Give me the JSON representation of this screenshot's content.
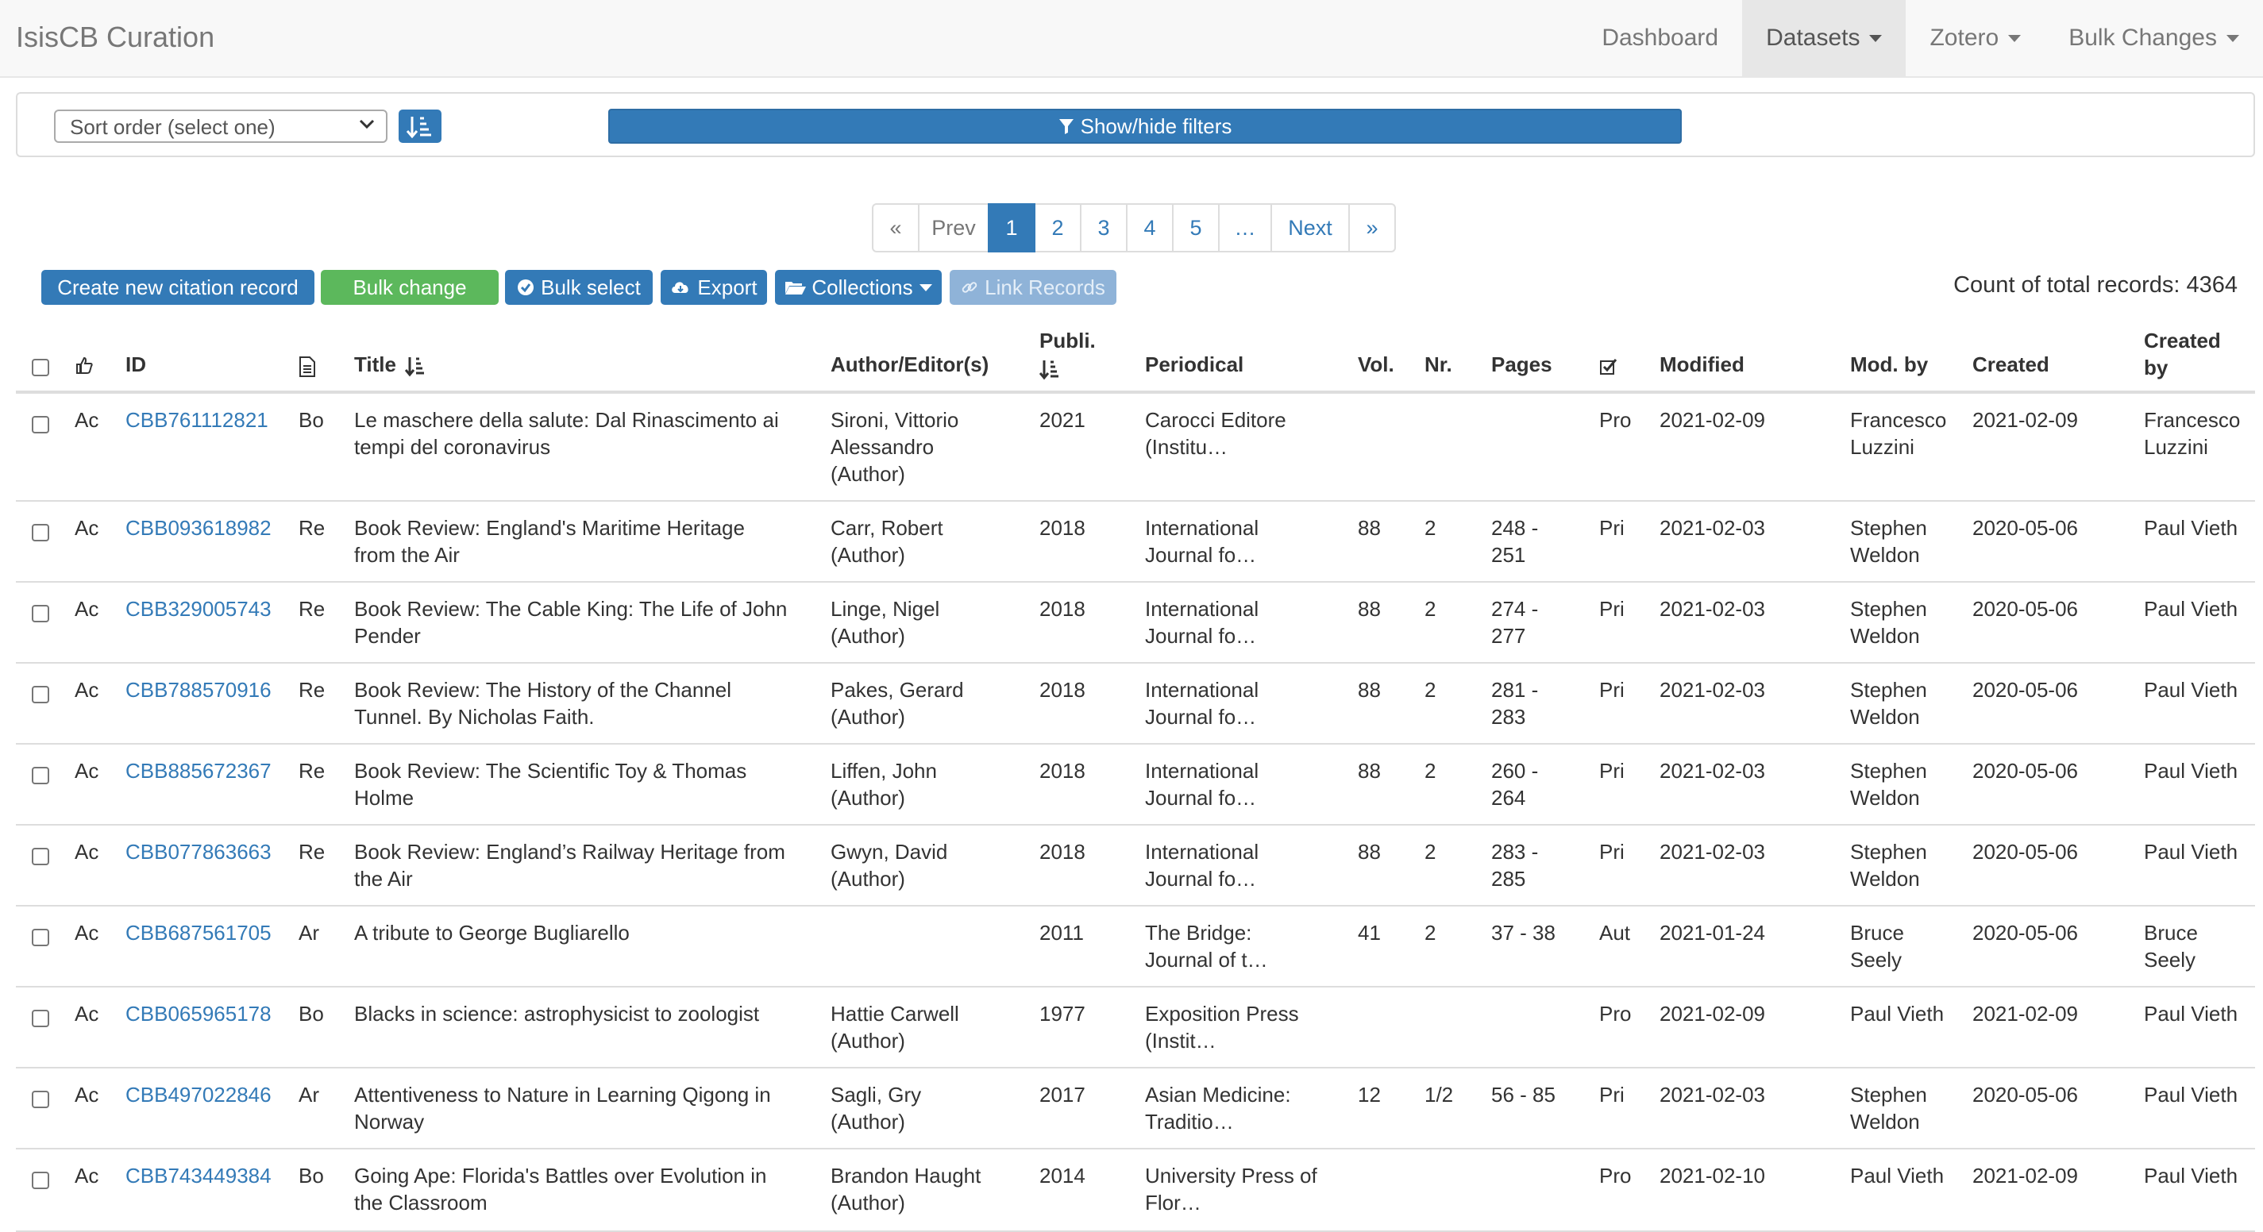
{
  "navbar": {
    "brand": "IsisCB Curation",
    "items": [
      {
        "label": "Dashboard",
        "dropdown": false,
        "active": false
      },
      {
        "label": "Datasets",
        "dropdown": true,
        "active": true
      },
      {
        "label": "Zotero",
        "dropdown": true,
        "active": false
      },
      {
        "label": "Bulk Changes",
        "dropdown": true,
        "active": false
      }
    ]
  },
  "filters": {
    "sort_placeholder": "Sort order (select one)",
    "show_hide_label": "Show/hide filters"
  },
  "pagination": {
    "first": "«",
    "prev": "Prev",
    "pages": [
      "1",
      "2",
      "3",
      "4",
      "5"
    ],
    "current": "1",
    "ellipsis": "…",
    "next": "Next",
    "last": "»"
  },
  "actions": {
    "create": "Create new citation record",
    "bulk_change": "Bulk change",
    "bulk_select": "Bulk select",
    "export": "Export",
    "collections": "Collections",
    "link_records": "Link Records"
  },
  "count_label": "Count of total records: 4364",
  "table": {
    "headers": {
      "id": "ID",
      "title": "Title",
      "authors": "Author/Editor(s)",
      "publi": "Publi.",
      "periodical": "Periodical",
      "vol": "Vol.",
      "nr": "Nr.",
      "pages": "Pages",
      "modified": "Modified",
      "mod_by": "Mod. by",
      "created": "Created",
      "created_by_1": "Created",
      "created_by_2": "by"
    },
    "rows": [
      {
        "status": "Ac",
        "id": "CBB761112821",
        "type": "Bo",
        "title": [
          "Le maschere della salute: Dal Rinascimento ai",
          "tempi del coronavirus"
        ],
        "authors": [
          "Sironi, Vittorio",
          "Alessandro",
          "(Author)"
        ],
        "year": "2021",
        "periodical": [
          "Carocci Editore",
          "(Institu…"
        ],
        "vol": "",
        "nr": "",
        "pages": [],
        "rec": "Pro",
        "modified": "2021-02-09",
        "mod_by": [
          "Francesco",
          "Luzzini"
        ],
        "created": "2021-02-09",
        "created_by": [
          "Francesco",
          "Luzzini"
        ]
      },
      {
        "status": "Ac",
        "id": "CBB093618982",
        "type": "Re",
        "title": [
          "Book Review: England's Maritime Heritage",
          "from the Air"
        ],
        "authors": [
          "Carr, Robert",
          "(Author)"
        ],
        "year": "2018",
        "periodical": [
          "International",
          "Journal fo…"
        ],
        "vol": "88",
        "nr": "2",
        "pages": [
          "248 -",
          "251"
        ],
        "rec": "Pri",
        "modified": "2021-02-03",
        "mod_by": [
          "Stephen",
          "Weldon"
        ],
        "created": "2020-05-06",
        "created_by": [
          "Paul Vieth"
        ]
      },
      {
        "status": "Ac",
        "id": "CBB329005743",
        "type": "Re",
        "title": [
          "Book Review: The Cable King: The Life of John",
          "Pender"
        ],
        "authors": [
          "Linge, Nigel",
          "(Author)"
        ],
        "year": "2018",
        "periodical": [
          "International",
          "Journal fo…"
        ],
        "vol": "88",
        "nr": "2",
        "pages": [
          "274 -",
          "277"
        ],
        "rec": "Pri",
        "modified": "2021-02-03",
        "mod_by": [
          "Stephen",
          "Weldon"
        ],
        "created": "2020-05-06",
        "created_by": [
          "Paul Vieth"
        ]
      },
      {
        "status": "Ac",
        "id": "CBB788570916",
        "type": "Re",
        "title": [
          "Book Review: The History of the Channel",
          "Tunnel. By Nicholas Faith."
        ],
        "authors": [
          "Pakes, Gerard",
          "(Author)"
        ],
        "year": "2018",
        "periodical": [
          "International",
          "Journal fo…"
        ],
        "vol": "88",
        "nr": "2",
        "pages": [
          "281 -",
          "283"
        ],
        "rec": "Pri",
        "modified": "2021-02-03",
        "mod_by": [
          "Stephen",
          "Weldon"
        ],
        "created": "2020-05-06",
        "created_by": [
          "Paul Vieth"
        ]
      },
      {
        "status": "Ac",
        "id": "CBB885672367",
        "type": "Re",
        "title": [
          "Book Review: The Scientific Toy & Thomas",
          "Holme"
        ],
        "authors": [
          "Liffen, John",
          "(Author)"
        ],
        "year": "2018",
        "periodical": [
          "International",
          "Journal fo…"
        ],
        "vol": "88",
        "nr": "2",
        "pages": [
          "260 -",
          "264"
        ],
        "rec": "Pri",
        "modified": "2021-02-03",
        "mod_by": [
          "Stephen",
          "Weldon"
        ],
        "created": "2020-05-06",
        "created_by": [
          "Paul Vieth"
        ]
      },
      {
        "status": "Ac",
        "id": "CBB077863663",
        "type": "Re",
        "title": [
          "Book Review: England’s Railway Heritage from",
          "the Air"
        ],
        "authors": [
          "Gwyn, David",
          "(Author)"
        ],
        "year": "2018",
        "periodical": [
          "International",
          "Journal fo…"
        ],
        "vol": "88",
        "nr": "2",
        "pages": [
          "283 -",
          "285"
        ],
        "rec": "Pri",
        "modified": "2021-02-03",
        "mod_by": [
          "Stephen",
          "Weldon"
        ],
        "created": "2020-05-06",
        "created_by": [
          "Paul Vieth"
        ]
      },
      {
        "status": "Ac",
        "id": "CBB687561705",
        "type": "Ar",
        "title": [
          "A tribute to George Bugliarello"
        ],
        "authors": [],
        "year": "2011",
        "periodical": [
          "The Bridge:",
          "Journal of t…"
        ],
        "vol": "41",
        "nr": "2",
        "pages": [
          "37 - 38"
        ],
        "rec": "Aut",
        "modified": "2021-01-24",
        "mod_by": [
          "Bruce",
          "Seely"
        ],
        "created": "2020-05-06",
        "created_by": [
          "Bruce",
          "Seely"
        ]
      },
      {
        "status": "Ac",
        "id": "CBB065965178",
        "type": "Bo",
        "title": [
          "Blacks in science: astrophysicist to zoologist"
        ],
        "authors": [
          "Hattie Carwell",
          "(Author)"
        ],
        "year": "1977",
        "periodical": [
          "Exposition Press",
          "(Instit…"
        ],
        "vol": "",
        "nr": "",
        "pages": [],
        "rec": "Pro",
        "modified": "2021-02-09",
        "mod_by": [
          "Paul Vieth"
        ],
        "created": "2021-02-09",
        "created_by": [
          "Paul Vieth"
        ]
      },
      {
        "status": "Ac",
        "id": "CBB497022846",
        "type": "Ar",
        "title": [
          "Attentiveness to Nature in Learning Qigong in",
          "Norway"
        ],
        "authors": [
          "Sagli, Gry",
          "(Author)"
        ],
        "year": "2017",
        "periodical": [
          "Asian Medicine:",
          "Traditio…"
        ],
        "vol": "12",
        "nr": "1/2",
        "pages": [
          "56 - 85"
        ],
        "rec": "Pri",
        "modified": "2021-02-03",
        "mod_by": [
          "Stephen",
          "Weldon"
        ],
        "created": "2020-05-06",
        "created_by": [
          "Paul Vieth"
        ]
      },
      {
        "status": "Ac",
        "id": "CBB743449384",
        "type": "Bo",
        "title": [
          "Going Ape: Florida's Battles over Evolution in",
          "the Classroom"
        ],
        "authors": [
          "Brandon Haught",
          "(Author)"
        ],
        "year": "2014",
        "periodical": [
          "University Press of",
          "Flor…"
        ],
        "vol": "",
        "nr": "",
        "pages": [],
        "rec": "Pro",
        "modified": "2021-02-10",
        "mod_by": [
          "Paul Vieth"
        ],
        "created": "2021-02-09",
        "created_by": [
          "Paul Vieth"
        ]
      }
    ]
  }
}
